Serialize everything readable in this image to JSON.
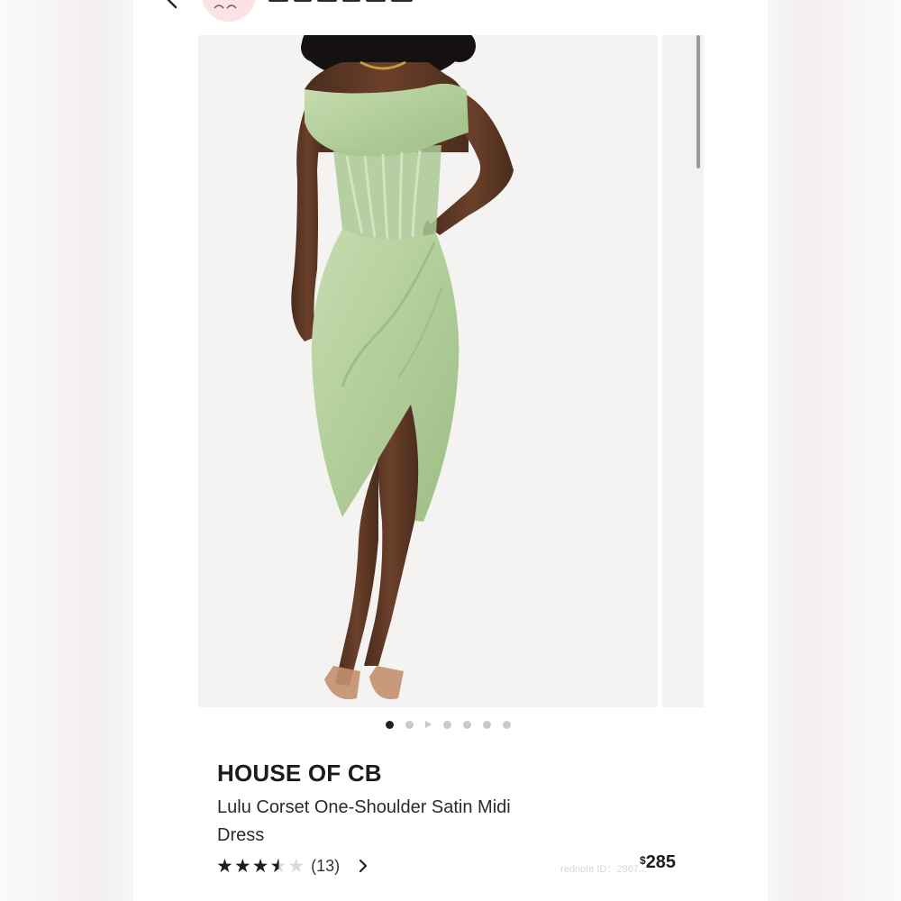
{
  "gallery": {
    "image_alt": "Model wearing a sage green one-shoulder satin corset midi dress",
    "page_count": 7,
    "active_index": 0,
    "video_index": 2
  },
  "product": {
    "brand": "HOUSE OF CB",
    "name": "Lulu Corset One-Shoulder Satin Midi Dress",
    "rating_stars": 3.5,
    "rating_max": 5,
    "review_count": "(13)",
    "price_currency": "$",
    "price_amount": "285"
  },
  "watermark": "rednote ID：2867...",
  "colors": {
    "dress": "#b7d1a0",
    "avatar_bg": "#fbe2e4",
    "active_dot": "#222222",
    "inactive_dot": "#c9c9c9"
  },
  "icons": [
    "back-chevron-icon",
    "chevron-right-icon",
    "star-icon",
    "play-icon"
  ]
}
